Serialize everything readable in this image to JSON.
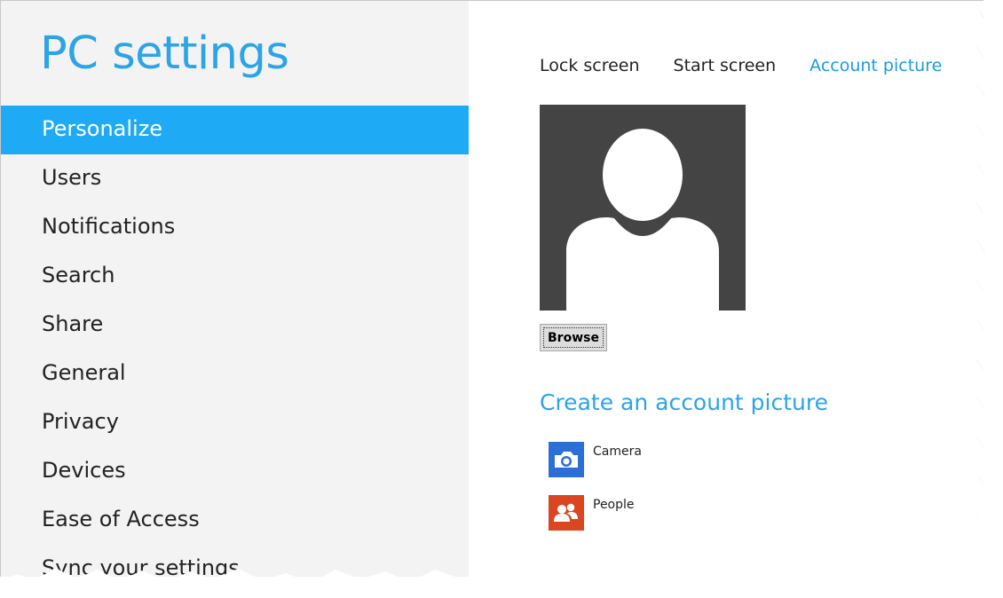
{
  "app": {
    "title": "PC settings"
  },
  "sidebar": {
    "items": [
      {
        "label": "Personalize",
        "active": true
      },
      {
        "label": "Users"
      },
      {
        "label": "Notifications"
      },
      {
        "label": "Search"
      },
      {
        "label": "Share"
      },
      {
        "label": "General"
      },
      {
        "label": "Privacy"
      },
      {
        "label": "Devices"
      },
      {
        "label": "Ease of Access"
      },
      {
        "label": "Sync your settings"
      }
    ]
  },
  "tabs": [
    {
      "label": "Lock screen"
    },
    {
      "label": "Start screen"
    },
    {
      "label": "Account picture",
      "active": true
    }
  ],
  "account_picture": {
    "browse_label": "Browse"
  },
  "create": {
    "title": "Create an account picture",
    "apps": [
      {
        "label": "Camera",
        "icon": "camera-icon",
        "color": "#2b6fd6"
      },
      {
        "label": "People",
        "icon": "people-icon",
        "color": "#d9461f"
      }
    ]
  },
  "colors": {
    "accent": "#1faaf6",
    "title": "#2ba4e8",
    "sidebar_bg": "#f3f3f3",
    "avatar_bg": "#444444"
  }
}
